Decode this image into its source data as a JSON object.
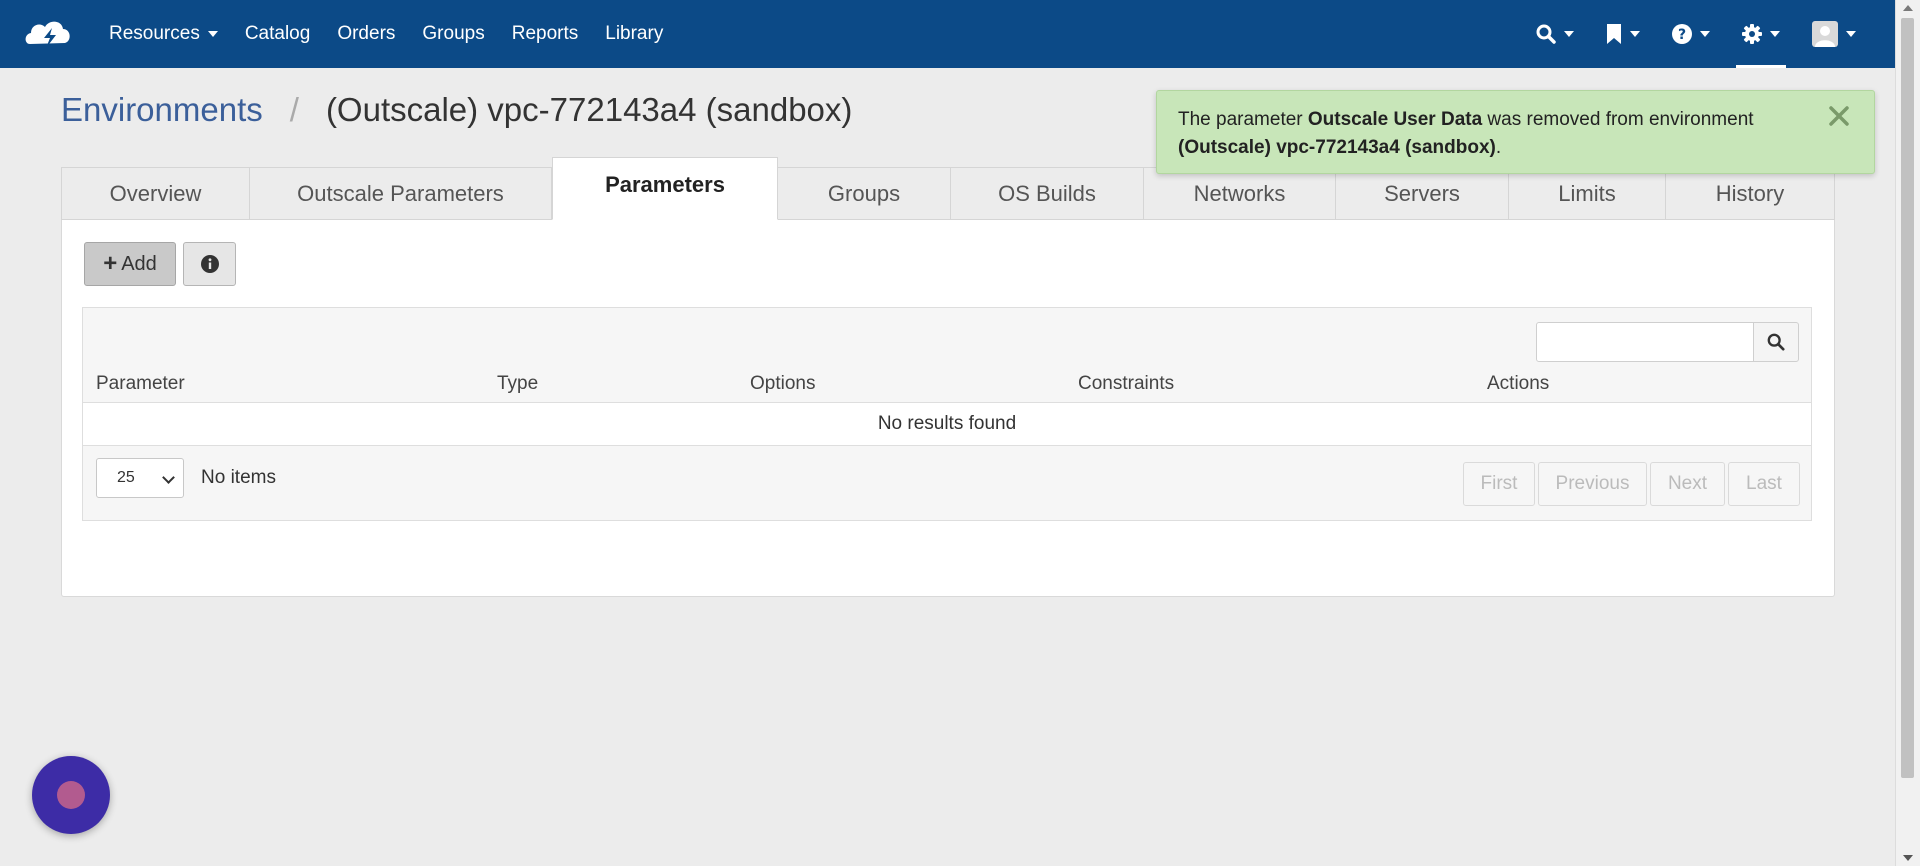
{
  "nav": {
    "links": [
      "Resources",
      "Catalog",
      "Orders",
      "Groups",
      "Reports",
      "Library"
    ],
    "icons": [
      "search-icon",
      "bookmark-icon",
      "help-icon",
      "settings-icon",
      "user-avatar"
    ]
  },
  "breadcrumb": {
    "parent": "Environments",
    "separator": "/",
    "current": "(Outscale) vpc-772143a4 (sandbox)"
  },
  "tabs": [
    "Overview",
    "Outscale Parameters",
    "Parameters",
    "Groups",
    "OS Builds",
    "Networks",
    "Servers",
    "Limits",
    "History"
  ],
  "toolbar": {
    "add_label": "Add"
  },
  "table": {
    "columns": [
      "Parameter",
      "Type",
      "Options",
      "Constraints",
      "Actions"
    ],
    "empty_text": "No results found",
    "page_size": "25",
    "items_text": "No items",
    "pager": [
      "First",
      "Previous",
      "Next",
      "Last"
    ]
  },
  "toast": {
    "prefix": "The parameter ",
    "param": "Outscale User Data",
    "middle": " was removed from environment ",
    "env": "(Outscale) vpc-772143a4 (sandbox)",
    "suffix": "."
  },
  "colors": {
    "navbar": "#0c4a87",
    "toast_bg": "#c8e6b9",
    "link": "#3b5f9a",
    "chat": "#3d2ca6"
  }
}
